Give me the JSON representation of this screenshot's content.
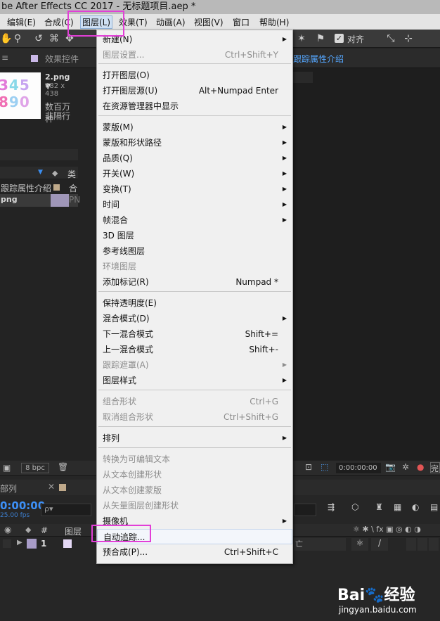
{
  "window": {
    "title": "be After Effects CC 2017 - 无标题项目.aep *"
  },
  "menubar": {
    "items": [
      "编辑(E)",
      "合成(C)",
      "图层(L)",
      "效果(T)",
      "动画(A)",
      "视图(V)",
      "窗口",
      "帮助(H)"
    ]
  },
  "toolbar": {
    "align_label": "对齐"
  },
  "tabs": {
    "effects_controls": "效果控件",
    "tracking_title": "跟踪属性介绍"
  },
  "project": {
    "file_name": "2.png ▼",
    "file_dims": "682 x 438",
    "desc_line1": "数百万种",
    "desc_line2": "非隔行",
    "type_col": "类",
    "row1_name": "跟踪属性介绍",
    "row1_type": "合",
    "row2_name": "png",
    "row2_type": "PN"
  },
  "footer": {
    "bpc": "8 bpc",
    "timecode_small": "0:00:00:00",
    "partial_right": "完"
  },
  "timeline": {
    "queue_tab": "部列",
    "timecode": "0:00:00",
    "fps": "25.00 fps",
    "col_hash": "#",
    "col_src": "图层",
    "layer_num": "1",
    "col_parent_partial": "亡",
    "search_placeholder": "ρ▾"
  },
  "menu": {
    "items": [
      {
        "label": "新建(N)",
        "shortcut": "",
        "submenu": true,
        "disabled": false
      },
      {
        "label": "图层设置...",
        "shortcut": "Ctrl+Shift+Y",
        "submenu": false,
        "disabled": true
      },
      {
        "label": "打开图层(O)",
        "shortcut": "",
        "submenu": false,
        "disabled": false
      },
      {
        "label": "打开图层源(U)",
        "shortcut": "Alt+Numpad Enter",
        "submenu": false,
        "disabled": false
      },
      {
        "label": "在资源管理器中显示",
        "shortcut": "",
        "submenu": false,
        "disabled": false
      },
      {
        "label": "蒙版(M)",
        "shortcut": "",
        "submenu": true,
        "disabled": false
      },
      {
        "label": "蒙版和形状路径",
        "shortcut": "",
        "submenu": true,
        "disabled": false
      },
      {
        "label": "品质(Q)",
        "shortcut": "",
        "submenu": true,
        "disabled": false
      },
      {
        "label": "开关(W)",
        "shortcut": "",
        "submenu": true,
        "disabled": false
      },
      {
        "label": "变换(T)",
        "shortcut": "",
        "submenu": true,
        "disabled": false
      },
      {
        "label": "时间",
        "shortcut": "",
        "submenu": true,
        "disabled": false
      },
      {
        "label": "帧混合",
        "shortcut": "",
        "submenu": true,
        "disabled": false
      },
      {
        "label": "3D 图层",
        "shortcut": "",
        "submenu": false,
        "disabled": false
      },
      {
        "label": "参考线图层",
        "shortcut": "",
        "submenu": false,
        "disabled": false
      },
      {
        "label": "环境图层",
        "shortcut": "",
        "submenu": false,
        "disabled": true
      },
      {
        "label": "添加标记(R)",
        "shortcut": "Numpad *",
        "submenu": false,
        "disabled": false
      },
      {
        "label": "保持透明度(E)",
        "shortcut": "",
        "submenu": false,
        "disabled": false
      },
      {
        "label": "混合模式(D)",
        "shortcut": "",
        "submenu": true,
        "disabled": false
      },
      {
        "label": "下一混合模式",
        "shortcut": "Shift+=",
        "submenu": false,
        "disabled": false
      },
      {
        "label": "上一混合模式",
        "shortcut": "Shift+-",
        "submenu": false,
        "disabled": false
      },
      {
        "label": "跟踪遮罩(A)",
        "shortcut": "",
        "submenu": true,
        "disabled": true
      },
      {
        "label": "图层样式",
        "shortcut": "",
        "submenu": true,
        "disabled": false
      },
      {
        "label": "组合形状",
        "shortcut": "Ctrl+G",
        "submenu": false,
        "disabled": true
      },
      {
        "label": "取消组合形状",
        "shortcut": "Ctrl+Shift+G",
        "submenu": false,
        "disabled": true
      },
      {
        "label": "排列",
        "shortcut": "",
        "submenu": true,
        "disabled": false
      },
      {
        "label": "转换为可编辑文本",
        "shortcut": "",
        "submenu": false,
        "disabled": true
      },
      {
        "label": "从文本创建形状",
        "shortcut": "",
        "submenu": false,
        "disabled": true
      },
      {
        "label": "从文本创建蒙版",
        "shortcut": "",
        "submenu": false,
        "disabled": true
      },
      {
        "label": "从矢量图层创建形状",
        "shortcut": "",
        "submenu": false,
        "disabled": true
      },
      {
        "label": "摄像机",
        "shortcut": "",
        "submenu": true,
        "disabled": false
      },
      {
        "label": "自动追踪...",
        "shortcut": "",
        "submenu": false,
        "disabled": false
      },
      {
        "label": "预合成(P)...",
        "shortcut": "Ctrl+Shift+C",
        "submenu": false,
        "disabled": false
      }
    ]
  },
  "watermark": {
    "brand": "Bai🐾经验",
    "url": "jingyan.baidu.com"
  },
  "colors": {
    "highlight": "#e23fd7",
    "menu_bg": "#f0f0f0",
    "accent_blue": "#2d8ceb"
  }
}
